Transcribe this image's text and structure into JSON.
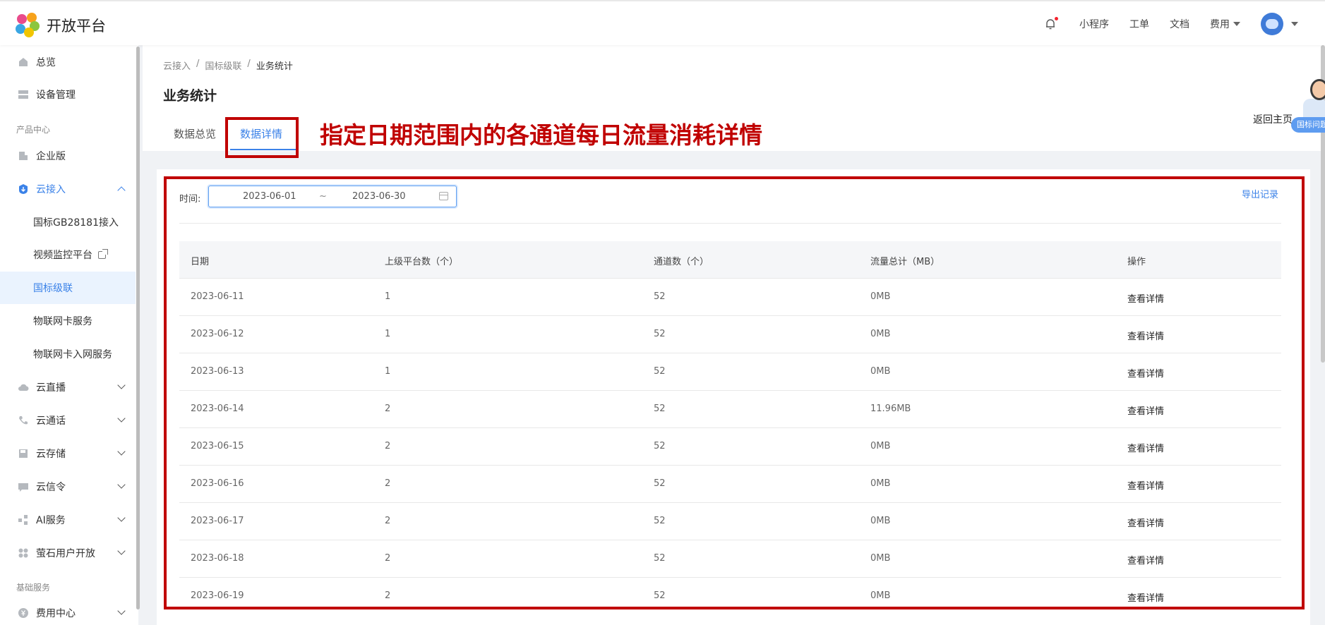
{
  "header": {
    "logo_text": "开放平台",
    "nav": [
      "小程序",
      "工单",
      "文档"
    ],
    "fee_label": "费用"
  },
  "sidebar": {
    "overview": "总览",
    "device_mgmt": "设备管理",
    "group_product": "产品中心",
    "enterprise": "企业版",
    "cloud_access": "云接入",
    "sub_items": [
      "国标GB28181接入",
      "视频监控平台",
      "国标级联",
      "物联网卡服务",
      "物联网卡入网服务"
    ],
    "cloud_live": "云直播",
    "cloud_call": "云通话",
    "cloud_storage": "云存储",
    "cloud_signal": "云信令",
    "ai_service": "AI服务",
    "ezviz_open": "萤石用户开放",
    "group_basic": "基础服务",
    "fee_center": "费用中心"
  },
  "breadcrumb": [
    "云接入",
    "/",
    "国标级联",
    "/",
    "业务统计"
  ],
  "page_title": "业务统计",
  "tabs": [
    "数据总览",
    "数据详情"
  ],
  "annotation_text": "指定日期范围内的各通道每日流量消耗详情",
  "back_home": "返回主页",
  "help_pill": "国标问题",
  "filter": {
    "label": "时间:",
    "start": "2023-06-01",
    "separator": "~",
    "end": "2023-06-30"
  },
  "export_label": "导出记录",
  "table": {
    "headers": [
      "日期",
      "上级平台数（个）",
      "通道数（个）",
      "流量总计（MB）",
      "操作"
    ],
    "rows": [
      [
        "2023-06-11",
        "1",
        "52",
        "0MB",
        "查看详情"
      ],
      [
        "2023-06-12",
        "1",
        "52",
        "0MB",
        "查看详情"
      ],
      [
        "2023-06-13",
        "1",
        "52",
        "0MB",
        "查看详情"
      ],
      [
        "2023-06-14",
        "2",
        "52",
        "11.96MB",
        "查看详情"
      ],
      [
        "2023-06-15",
        "2",
        "52",
        "0MB",
        "查看详情"
      ],
      [
        "2023-06-16",
        "2",
        "52",
        "0MB",
        "查看详情"
      ],
      [
        "2023-06-17",
        "2",
        "52",
        "0MB",
        "查看详情"
      ],
      [
        "2023-06-18",
        "2",
        "52",
        "0MB",
        "查看详情"
      ],
      [
        "2023-06-19",
        "2",
        "52",
        "0MB",
        "查看详情"
      ]
    ]
  }
}
